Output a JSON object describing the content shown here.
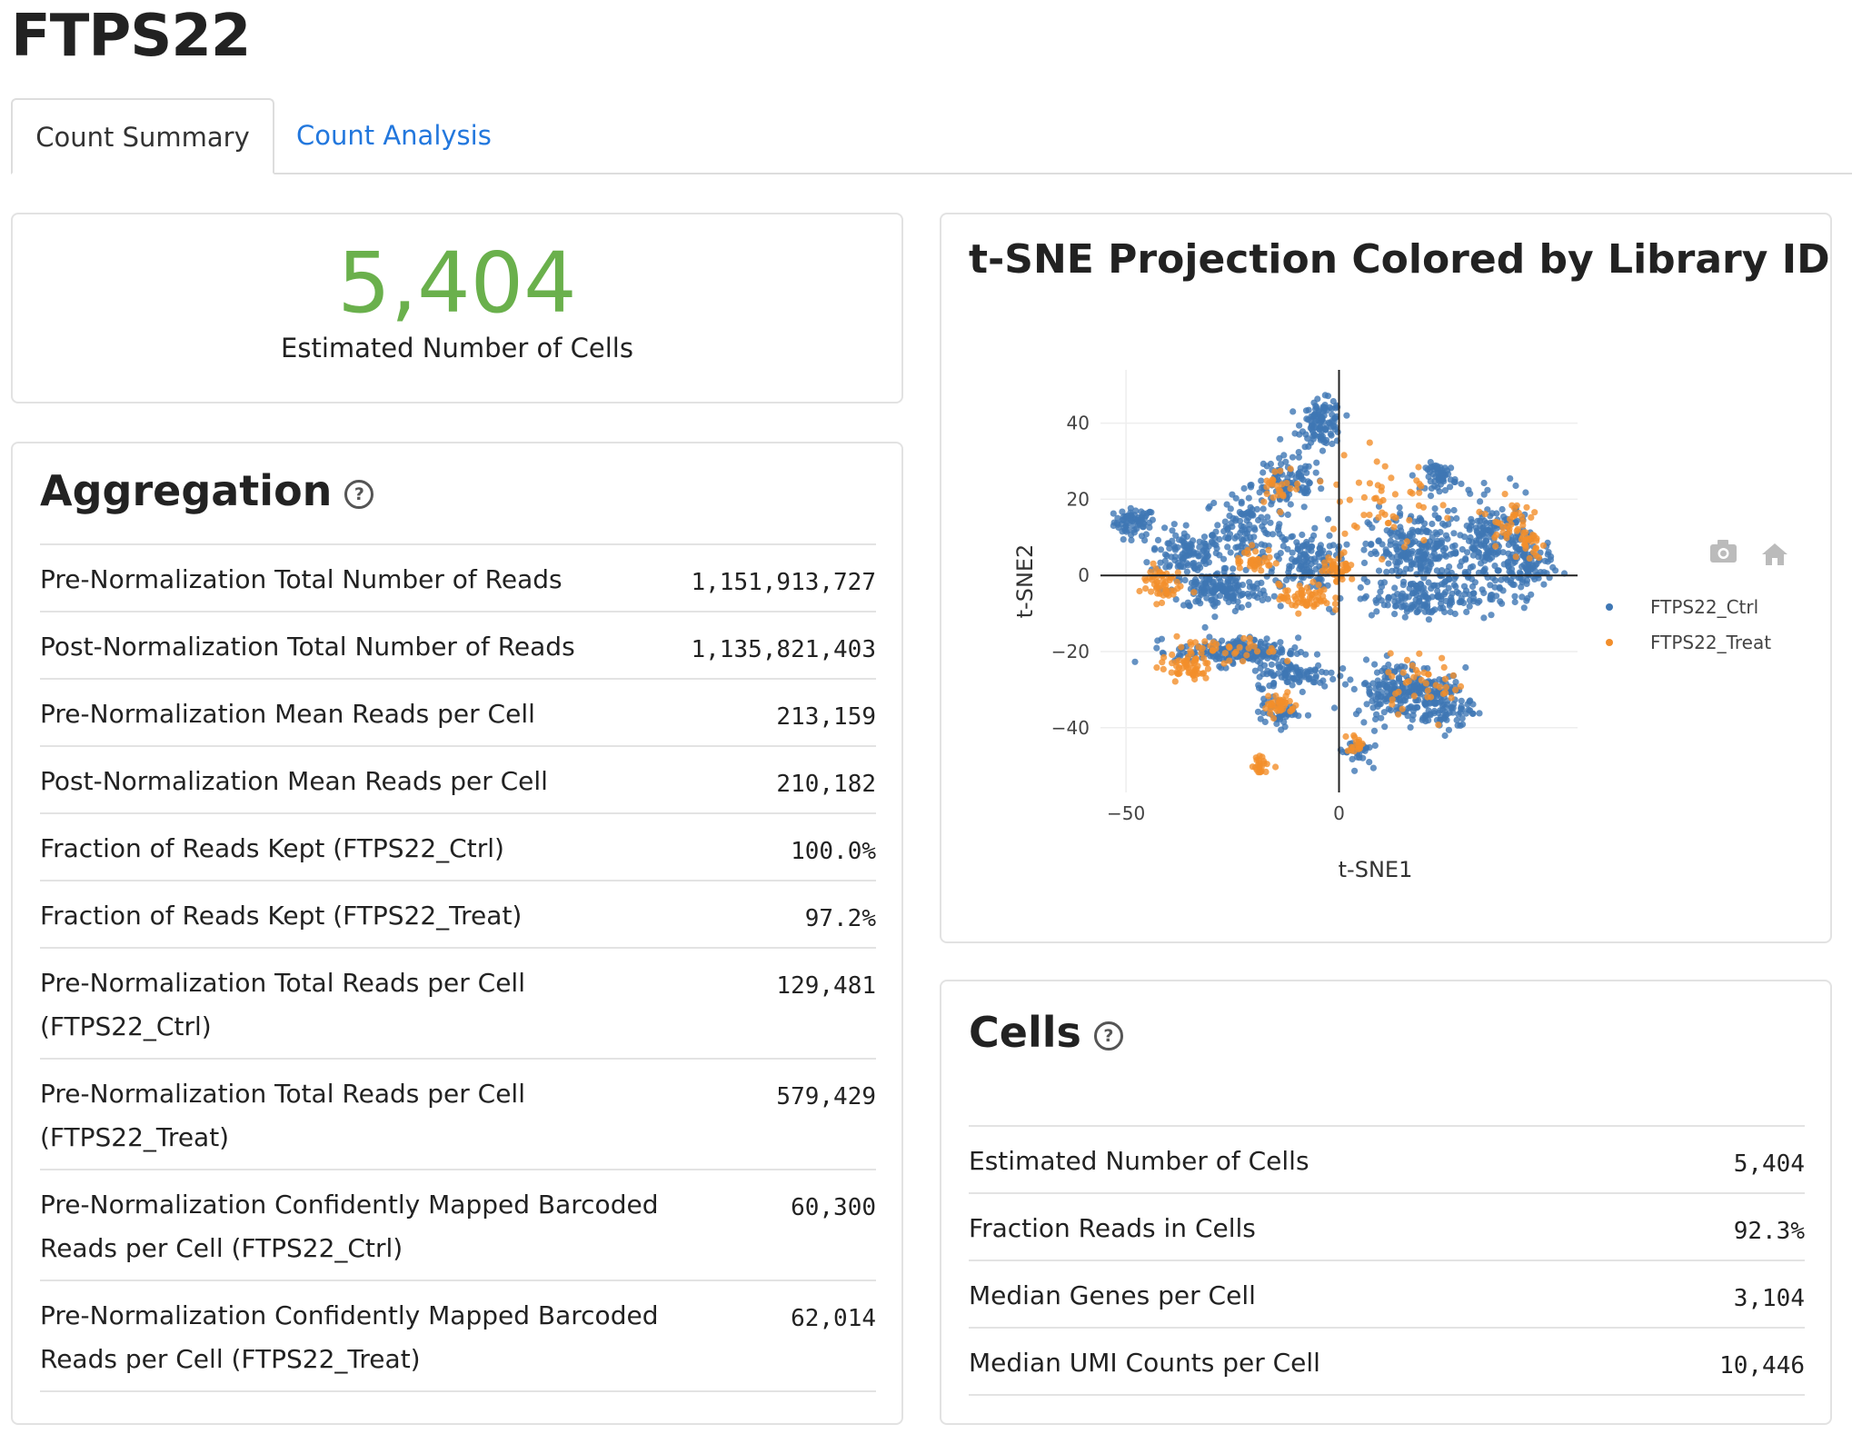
{
  "page": {
    "title": "FTPS22"
  },
  "tabs": [
    {
      "label": "Count Summary",
      "active": true
    },
    {
      "label": "Count Analysis",
      "active": false
    }
  ],
  "summary": {
    "value": "5,404",
    "label": "Estimated Number of Cells",
    "color": "#6ab04c"
  },
  "aggregation": {
    "title": "Aggregation",
    "help_icon": "question-circle-icon",
    "rows": [
      {
        "label": "Pre-Normalization Total Number of Reads",
        "value": "1,151,913,727"
      },
      {
        "label": "Post-Normalization Total Number of Reads",
        "value": "1,135,821,403"
      },
      {
        "label": "Pre-Normalization Mean Reads per Cell",
        "value": "213,159"
      },
      {
        "label": "Post-Normalization Mean Reads per Cell",
        "value": "210,182"
      },
      {
        "label": "Fraction of Reads Kept (FTPS22_Ctrl)",
        "value": "100.0%"
      },
      {
        "label": "Fraction of Reads Kept (FTPS22_Treat)",
        "value": "97.2%"
      },
      {
        "label": "Pre-Normalization Total Reads per Cell",
        "label2": "(FTPS22_Ctrl)",
        "value": "129,481"
      },
      {
        "label": "Pre-Normalization Total Reads per Cell",
        "label2": "(FTPS22_Treat)",
        "value": "579,429"
      },
      {
        "label": "Pre-Normalization Confidently Mapped Barcoded",
        "label2": "Reads per Cell (FTPS22_Ctrl)",
        "value": "60,300"
      },
      {
        "label": "Pre-Normalization Confidently Mapped Barcoded",
        "label2": "Reads per Cell (FTPS22_Treat)",
        "value": "62,014"
      }
    ]
  },
  "cells": {
    "title": "Cells",
    "help_icon": "question-circle-icon",
    "rows": [
      {
        "label": "Estimated Number of Cells",
        "value": "5,404"
      },
      {
        "label": "Fraction Reads in Cells",
        "value": "92.3%"
      },
      {
        "label": "Median Genes per Cell",
        "value": "3,104"
      },
      {
        "label": "Median UMI Counts per Cell",
        "value": "10,446"
      }
    ]
  },
  "toolbar": {
    "icons": [
      "camera-icon",
      "home-icon"
    ]
  },
  "chart_data": {
    "type": "scatter",
    "title": "t-SNE Projection Colored by Library ID",
    "xlabel": "t-SNE1",
    "ylabel": "t-SNE2",
    "xlim": [
      -56,
      56
    ],
    "ylim": [
      -57,
      54
    ],
    "xticks": [
      {
        "v": -50,
        "label": "−50"
      },
      {
        "v": 0,
        "label": "0"
      }
    ],
    "yticks": [
      {
        "v": 40,
        "label": "40"
      },
      {
        "v": 20,
        "label": "20"
      },
      {
        "v": 0,
        "label": "0"
      },
      {
        "v": -20,
        "label": "−20"
      },
      {
        "v": -40,
        "label": "−40"
      }
    ],
    "grid": true,
    "legend_position": "top-right",
    "series": [
      {
        "name": "FTPS22_Ctrl",
        "color": "#3f77b4",
        "clusters": [
          {
            "cx": -48,
            "cy": 14,
            "sx": 4,
            "sy": 3,
            "n": 70
          },
          {
            "cx": -36,
            "cy": 6,
            "sx": 7,
            "sy": 5,
            "n": 110
          },
          {
            "cx": -22,
            "cy": 12,
            "sx": 8,
            "sy": 8,
            "n": 130
          },
          {
            "cx": -12,
            "cy": 24,
            "sx": 7,
            "sy": 6,
            "n": 100
          },
          {
            "cx": -4,
            "cy": 40,
            "sx": 4,
            "sy": 5,
            "n": 110
          },
          {
            "cx": -28,
            "cy": -4,
            "sx": 10,
            "sy": 4,
            "n": 160
          },
          {
            "cx": -8,
            "cy": 4,
            "sx": 6,
            "sy": 6,
            "n": 120
          },
          {
            "cx": 18,
            "cy": 6,
            "sx": 9,
            "sy": 9,
            "n": 240
          },
          {
            "cx": 24,
            "cy": 26,
            "sx": 3,
            "sy": 3,
            "n": 60
          },
          {
            "cx": 36,
            "cy": 8,
            "sx": 8,
            "sy": 10,
            "n": 200
          },
          {
            "cx": 44,
            "cy": 2,
            "sx": 5,
            "sy": 6,
            "n": 90
          },
          {
            "cx": 20,
            "cy": -6,
            "sx": 14,
            "sy": 4,
            "n": 150
          },
          {
            "cx": -24,
            "cy": -20,
            "sx": 12,
            "sy": 3,
            "n": 180
          },
          {
            "cx": -10,
            "cy": -26,
            "sx": 8,
            "sy": 3,
            "n": 90
          },
          {
            "cx": 14,
            "cy": -30,
            "sx": 9,
            "sy": 6,
            "n": 190
          },
          {
            "cx": 24,
            "cy": -34,
            "sx": 6,
            "sy": 6,
            "n": 110
          },
          {
            "cx": -14,
            "cy": -36,
            "sx": 4,
            "sy": 3,
            "n": 50
          },
          {
            "cx": 4,
            "cy": -46,
            "sx": 3,
            "sy": 3,
            "n": 35
          }
        ]
      },
      {
        "name": "FTPS22_Treat",
        "color": "#f28e2b",
        "clusters": [
          {
            "cx": -42,
            "cy": -2,
            "sx": 4,
            "sy": 4,
            "n": 55
          },
          {
            "cx": -36,
            "cy": -24,
            "sx": 5,
            "sy": 3,
            "n": 55
          },
          {
            "cx": -8,
            "cy": -6,
            "sx": 5,
            "sy": 3,
            "n": 60
          },
          {
            "cx": -20,
            "cy": 4,
            "sx": 4,
            "sy": 3,
            "n": 35
          },
          {
            "cx": 0,
            "cy": 2,
            "sx": 3,
            "sy": 3,
            "n": 40
          },
          {
            "cx": -14,
            "cy": 24,
            "sx": 4,
            "sy": 4,
            "n": 25
          },
          {
            "cx": -18,
            "cy": -50,
            "sx": 2,
            "sy": 2,
            "n": 22
          },
          {
            "cx": 4,
            "cy": -44,
            "sx": 2,
            "sy": 2,
            "n": 18
          },
          {
            "cx": -14,
            "cy": -34,
            "sx": 3,
            "sy": 3,
            "n": 35
          },
          {
            "cx": 40,
            "cy": 14,
            "sx": 4,
            "sy": 5,
            "n": 40
          },
          {
            "cx": 45,
            "cy": 8,
            "sx": 2,
            "sy": 3,
            "n": 20
          },
          {
            "cx": 10,
            "cy": 20,
            "sx": 10,
            "sy": 14,
            "n": 50
          },
          {
            "cx": 20,
            "cy": -28,
            "sx": 9,
            "sy": 6,
            "n": 40
          },
          {
            "cx": -26,
            "cy": -20,
            "sx": 10,
            "sy": 3,
            "n": 35
          }
        ]
      }
    ]
  }
}
